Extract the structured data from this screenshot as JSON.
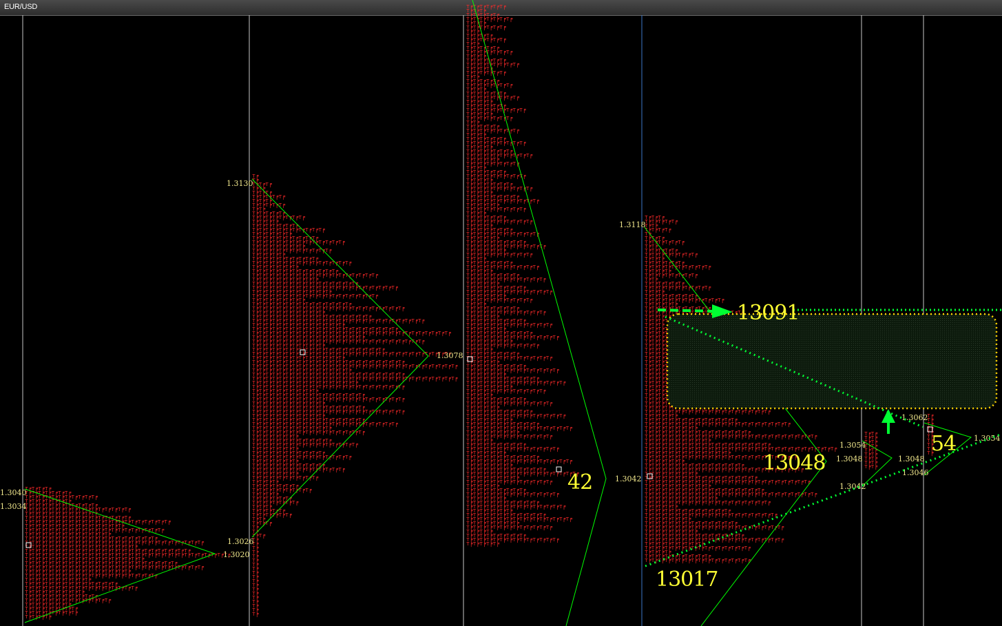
{
  "window": {
    "title": "EUR/USD"
  },
  "colors": {
    "background": "#000000",
    "tpo_letters": "#ff2a2a",
    "session_line": "#c8c8c8",
    "current_session_line": "#3c78c8",
    "profile_outline": "#00ff00",
    "price_label": "#f0e68c",
    "annotation_text": "#ffff33",
    "annotation_green": "#00ff33",
    "annotation_yellow": "#ffd400",
    "poc_marker": "#ffffff",
    "open_marker": "#ffff66"
  },
  "chart_data": {
    "type": "market-profile",
    "instrument": "EUR/USD",
    "sessions": [
      {
        "id": "s1",
        "price_labels": [
          {
            "text": "1.3040",
            "price": 1.304
          },
          {
            "text": "1.3034",
            "price": 1.3034
          },
          {
            "text": "1.3020",
            "price": 1.302
          }
        ],
        "high": 1.304,
        "low": 1.2997,
        "poc": 1.302
      },
      {
        "id": "s2",
        "price_labels": [
          {
            "text": "1.3130",
            "price": 1.313
          },
          {
            "text": "1.3078",
            "price": 1.3078
          },
          {
            "text": "1.3026",
            "price": 1.3026
          }
        ],
        "high": 1.313,
        "low": 1.3,
        "poc": 1.3078
      },
      {
        "id": "s3",
        "price_labels": [],
        "high": 1.318,
        "low": 1.303,
        "poc": 1.3042
      },
      {
        "id": "s4",
        "price_labels": [
          {
            "text": "1.3118",
            "price": 1.3118
          },
          {
            "text": "1.3042",
            "price": 1.3042
          }
        ],
        "high": 1.3118,
        "low": 1.301,
        "poc": 1.3048
      },
      {
        "id": "s5",
        "price_labels": [
          {
            "text": "1.3054",
            "price": 1.3054
          },
          {
            "text": "1.3048",
            "price": 1.3048
          },
          {
            "text": "1.3042",
            "price": 1.3042
          }
        ],
        "high": 1.3054,
        "low": 1.3042,
        "poc": 1.3048
      },
      {
        "id": "s6",
        "price_labels": [
          {
            "text": "1.3062",
            "price": 1.3062
          },
          {
            "text": "1.3048",
            "price": 1.3048
          },
          {
            "text": "1.3046",
            "price": 1.3046
          },
          {
            "text": "1.3054",
            "price": 1.3054
          }
        ],
        "high": 1.3062,
        "low": 1.3046,
        "poc": 1.3054
      }
    ],
    "annotations": [
      {
        "id": "ann-13091",
        "text": "13091"
      },
      {
        "id": "ann-13048",
        "text": "13048"
      },
      {
        "id": "ann-13017",
        "text": "13017"
      },
      {
        "id": "ann-42",
        "text": "42"
      },
      {
        "id": "ann-54",
        "text": "54"
      }
    ],
    "tpo_glyph": "⊤╒"
  }
}
